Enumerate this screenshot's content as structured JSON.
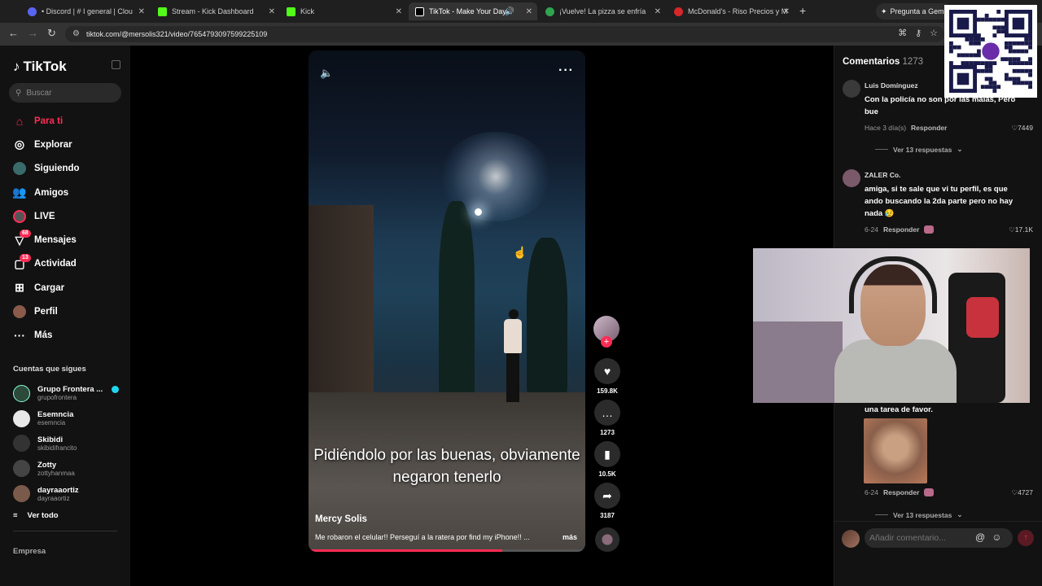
{
  "browser": {
    "tabs": [
      {
        "title": "• Discord | # I general | Clou",
        "color": "#5865f2",
        "active": false
      },
      {
        "title": "Stream - Kick Dashboard",
        "color": "#53fc18",
        "active": false
      },
      {
        "title": "Kick",
        "color": "#53fc18",
        "active": false
      },
      {
        "title": "TikTok - Make Your Day",
        "color": "#ffffff",
        "active": true
      },
      {
        "title": "¡Vuelve! La pizza se enfría",
        "color": "#2ea44f",
        "active": false
      },
      {
        "title": "McDonald's - Riso Precios y M",
        "color": "#d62828",
        "active": false
      }
    ],
    "gemini_label": "Pregunta a Gemi",
    "url": "tiktok.com/@mersolis321/video/7654793097599225109"
  },
  "sidebar": {
    "logo": "TikTok",
    "search_placeholder": "Buscar",
    "items": [
      {
        "label": "Para ti",
        "icon": "home-icon",
        "active": true
      },
      {
        "label": "Explorar",
        "icon": "compass-icon"
      },
      {
        "label": "Siguiendo",
        "icon": "following-icon"
      },
      {
        "label": "Amigos",
        "icon": "friends-icon"
      },
      {
        "label": "LIVE",
        "icon": "live-icon"
      },
      {
        "label": "Mensajes",
        "icon": "messages-icon",
        "badge": "68"
      },
      {
        "label": "Actividad",
        "icon": "activity-icon",
        "badge": "13"
      },
      {
        "label": "Cargar",
        "icon": "upload-icon"
      },
      {
        "label": "Perfil",
        "icon": "profile-icon"
      },
      {
        "label": "Más",
        "icon": "more-icon"
      }
    ],
    "following_title": "Cuentas que sigues",
    "following": [
      {
        "name": "Grupo Frontera ...",
        "handle": "grupofrontera",
        "verified": true
      },
      {
        "name": "Esemncia",
        "handle": "esemncia"
      },
      {
        "name": "Skibidi",
        "handle": "skibidifrancito"
      },
      {
        "name": "Zotty",
        "handle": "zottyhanmaa"
      },
      {
        "name": "dayraaortiz",
        "handle": "dayraaortiz"
      }
    ],
    "see_all": "Ver todo",
    "footer": "Empresa"
  },
  "video": {
    "subtitle": "Pidiéndolo por las buenas, obviamente negaron tenerlo",
    "author": "Mercy Solis",
    "description": "Me robaron el celular!! Perseguí a la ratera por find my iPhone!! ...",
    "more": "más",
    "progress": 0.7
  },
  "actions": {
    "likes": "159.8K",
    "comments": "1273",
    "saves": "10.5K",
    "shares": "3187"
  },
  "comments_panel": {
    "title": "Comentarios",
    "count": "1273",
    "items": [
      {
        "user": "Luis Domínguez",
        "text": "Con la policía no son por las malas, Pero bue",
        "time": "Hace 3 día(s)",
        "reply": "Responder",
        "likes": "7449",
        "replies": "Ver 13 respuestas"
      },
      {
        "user": "ZALER Co.",
        "text": "amiga, si te sale que vi tu perfil, es que ando buscando la 2da parte pero no hay nada 😥",
        "time": "6-24",
        "reply": "Responder",
        "likes": "17.1K"
      },
      {
        "text": "una tarea de favor.",
        "time": "6-24",
        "reply": "Responder",
        "likes": "4727",
        "replies": "Ver 13 respuestas"
      }
    ],
    "input_placeholder": "Añadir comentario..."
  }
}
